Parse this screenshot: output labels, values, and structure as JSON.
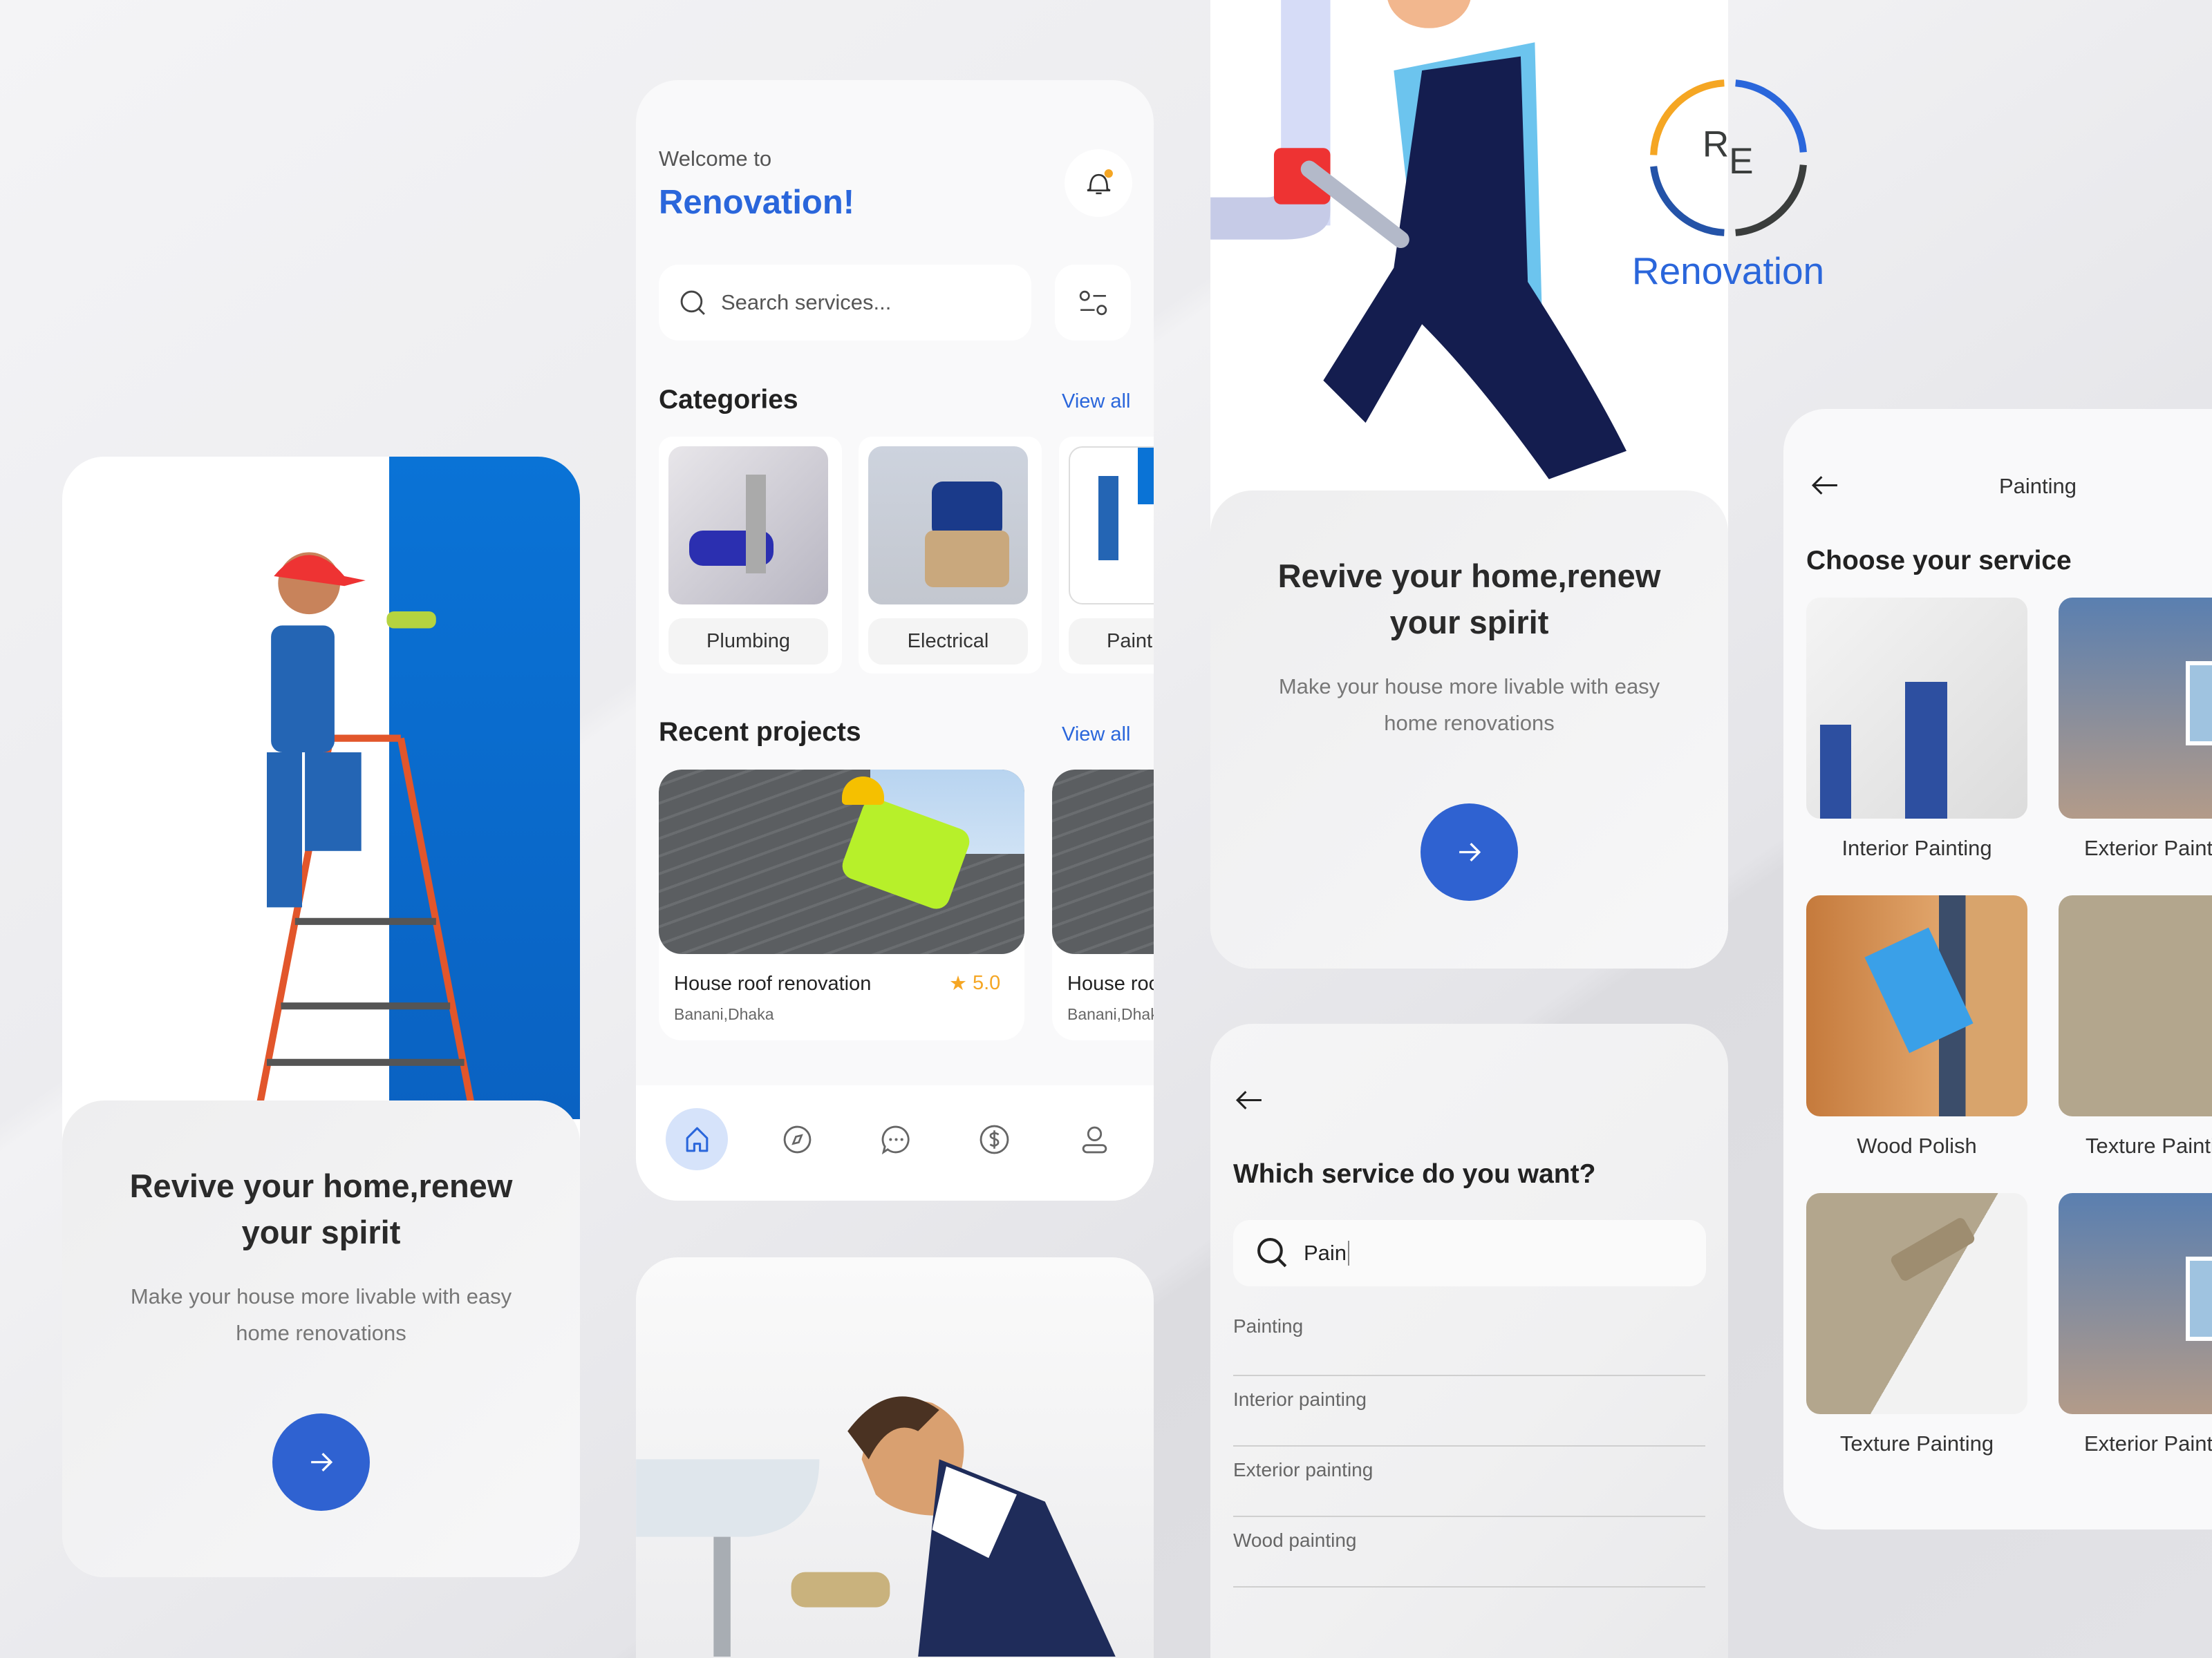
{
  "onboarding": {
    "title_line1": "Revive your home,renew",
    "title_line2": "your spirit",
    "subtitle_line1": "Make your house more livable with easy",
    "subtitle_line2": "home renovations",
    "next_icon": "arrow-right-icon"
  },
  "home": {
    "welcome": "Welcome to",
    "app_name": "Renovation!",
    "search_placeholder": "Search services...",
    "categories_title": "Categories",
    "view_all": "View all",
    "categories": [
      {
        "label": "Plumbing"
      },
      {
        "label": "Electrical"
      },
      {
        "label": "Painting"
      }
    ],
    "recent_title": "Recent projects",
    "projects": [
      {
        "title": "House roof renovation",
        "location": "Banani,Dhaka",
        "rating": "5.0"
      },
      {
        "title": "House roof renovation",
        "location": "Banani,Dhaka"
      }
    ],
    "nav": [
      "home-icon",
      "compass-icon",
      "chat-icon",
      "dollar-icon",
      "profile-icon"
    ]
  },
  "logo": {
    "monogram": "RE",
    "name": "Renovation",
    "colors": [
      "#f5a623",
      "#2a66db",
      "#2453a8",
      "#3a3d3c"
    ]
  },
  "service_search": {
    "title": "Which service do you want?",
    "query": "Pain",
    "results": [
      "Painting",
      "Interior painting",
      "Exterior painting",
      "Wood painting"
    ]
  },
  "painting": {
    "header": "Painting",
    "title": "Choose your service",
    "services": [
      "Interior Painting",
      "Exterior Painting",
      "Wood Polish",
      "Texture Painting",
      "Texture Painting",
      "Exterior Painting"
    ]
  },
  "colors": {
    "primary": "#2f62d1",
    "accent": "#f5a623",
    "brand_blue": "#2a66db"
  }
}
